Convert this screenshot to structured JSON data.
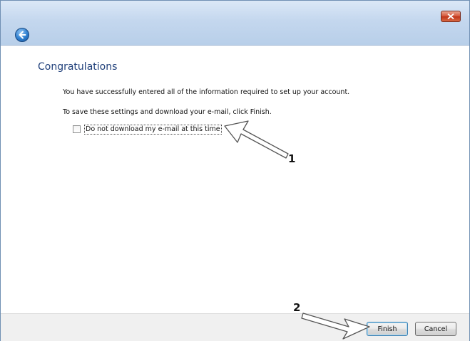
{
  "window": {
    "close_icon": "close-icon",
    "back_icon": "back-arrow-icon"
  },
  "page": {
    "heading": "Congratulations",
    "line1": "You have successfully entered all of the information required to set up your account.",
    "line2": "To save these settings and download your e-mail, click Finish.",
    "checkbox": {
      "label": "Do not download my e-mail at this time",
      "checked": false
    }
  },
  "buttons": {
    "finish_label": "Finish",
    "cancel_label": "Cancel"
  },
  "annotations": {
    "marker1": "1",
    "marker2": "2"
  },
  "colors": {
    "heading": "#1f3f7a",
    "titlebar": "#c4d7ee",
    "close_button": "#c0341a",
    "back_button": "#2f7fcf"
  }
}
